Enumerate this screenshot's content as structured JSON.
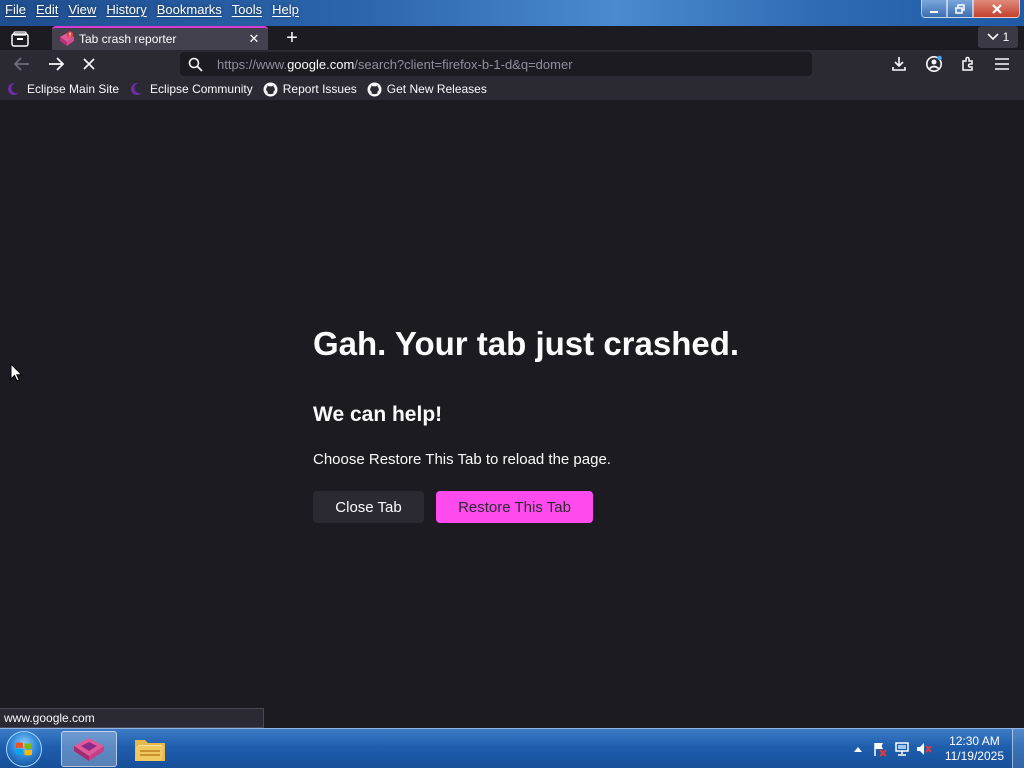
{
  "menubar": {
    "items": [
      "File",
      "Edit",
      "View",
      "History",
      "Bookmarks",
      "Tools",
      "Help"
    ]
  },
  "window_controls": {
    "minimize_icon": "minimize-icon",
    "maximize_icon": "restore-icon",
    "close_icon": "close-icon"
  },
  "tabstrip": {
    "active_tab": {
      "title": "Tab crash reporter",
      "favicon": "crashed-tab-icon",
      "close": "✕"
    },
    "new_tab": "+",
    "tab_count": "1"
  },
  "navbar": {
    "url_prefix": "https://www.",
    "url_host": "google.com",
    "url_suffix": "/search?client=firefox-b-1-d&q=domer"
  },
  "bookmarks": [
    {
      "label": "Eclipse Main Site",
      "icon": "eclipse-icon"
    },
    {
      "label": "Eclipse Community",
      "icon": "eclipse-icon"
    },
    {
      "label": "Report Issues",
      "icon": "github-icon"
    },
    {
      "label": "Get New Releases",
      "icon": "github-icon"
    }
  ],
  "crash_page": {
    "title": "Gah. Your tab just crashed.",
    "subtitle": "We can help!",
    "description": "Choose Restore This Tab to reload the page.",
    "close_button": "Close Tab",
    "restore_button": "Restore This Tab"
  },
  "status_url": "www.google.com",
  "taskbar": {
    "time": "12:30 AM",
    "date": "11/19/2025"
  },
  "colors": {
    "page_bg": "#1c1b22",
    "toolbar_bg": "#2b2a33",
    "accent": "#ff4aed",
    "tab_accent": "#d63bd4"
  }
}
